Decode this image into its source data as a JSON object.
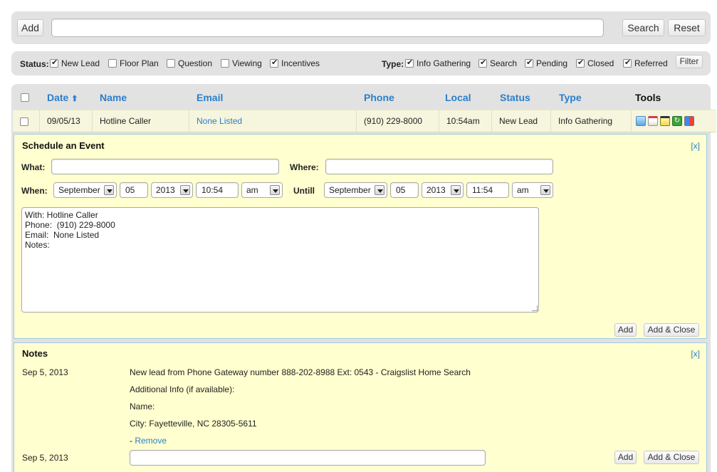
{
  "topbar": {
    "add_label": "Add",
    "search_value": "",
    "search_label": "Search",
    "reset_label": "Reset"
  },
  "filters": {
    "status_label": "Status:",
    "status_items": [
      {
        "label": "New Lead",
        "checked": true
      },
      {
        "label": "Floor Plan",
        "checked": false
      },
      {
        "label": "Question",
        "checked": false
      },
      {
        "label": "Viewing",
        "checked": false
      },
      {
        "label": "Incentives",
        "checked": true
      }
    ],
    "type_label": "Type:",
    "type_items": [
      {
        "label": "Info Gathering",
        "checked": true
      },
      {
        "label": "Search",
        "checked": true
      },
      {
        "label": "Pending",
        "checked": true
      },
      {
        "label": "Closed",
        "checked": true
      },
      {
        "label": "Referred",
        "checked": true
      }
    ],
    "filter_label": "Filter"
  },
  "table": {
    "headers": {
      "date": "Date",
      "name": "Name",
      "email": "Email",
      "phone": "Phone",
      "local": "Local",
      "status": "Status",
      "type": "Type",
      "tools": "Tools"
    },
    "row": {
      "date": "09/05/13",
      "name": "Hotline Caller",
      "email": "None Listed",
      "phone": "(910) 229-8000",
      "local": "10:54am",
      "status": "New Lead",
      "type": "Info Gathering"
    },
    "tool_icons": [
      "person-icon",
      "calendar-icon",
      "note-icon",
      "refresh-icon",
      "google-icon"
    ]
  },
  "event": {
    "title": "Schedule an Event",
    "close": "[x]",
    "what_label": "What:",
    "what_value": "",
    "where_label": "Where:",
    "where_value": "",
    "when_label": "When:",
    "until_label": "Untill",
    "start": {
      "month": "September",
      "day": "05",
      "year": "2013",
      "time": "10:54",
      "ampm": "am"
    },
    "end": {
      "month": "September",
      "day": "05",
      "year": "2013",
      "time": "11:54",
      "ampm": "am"
    },
    "notes_lines": [
      "With: Hotline Caller",
      "Phone:  (910) 229-8000",
      "Email:  None Listed",
      "Notes:"
    ],
    "add_label": "Add",
    "add_close_label": "Add & Close"
  },
  "notes": {
    "title": "Notes",
    "close": "[x]",
    "entry_date": "Sep 5, 2013",
    "entry_lines": [
      "New lead from Phone Gateway number 888-202-8988 Ext: 0543 - Craigslist Home Search",
      "Additional Info (if available):",
      "Name:",
      "City: Fayetteville, NC 28305-5611"
    ],
    "remove_prefix": "- ",
    "remove_label": "Remove",
    "new_date": "Sep 5, 2013",
    "new_value": "",
    "add_label": "Add",
    "add_close_label": "Add & Close"
  },
  "colors": {
    "link": "#2a7fc9",
    "panel_bg": "#ffffcf",
    "panel_border": "#9fcbe6",
    "bar_bg": "#e2e2e2"
  }
}
